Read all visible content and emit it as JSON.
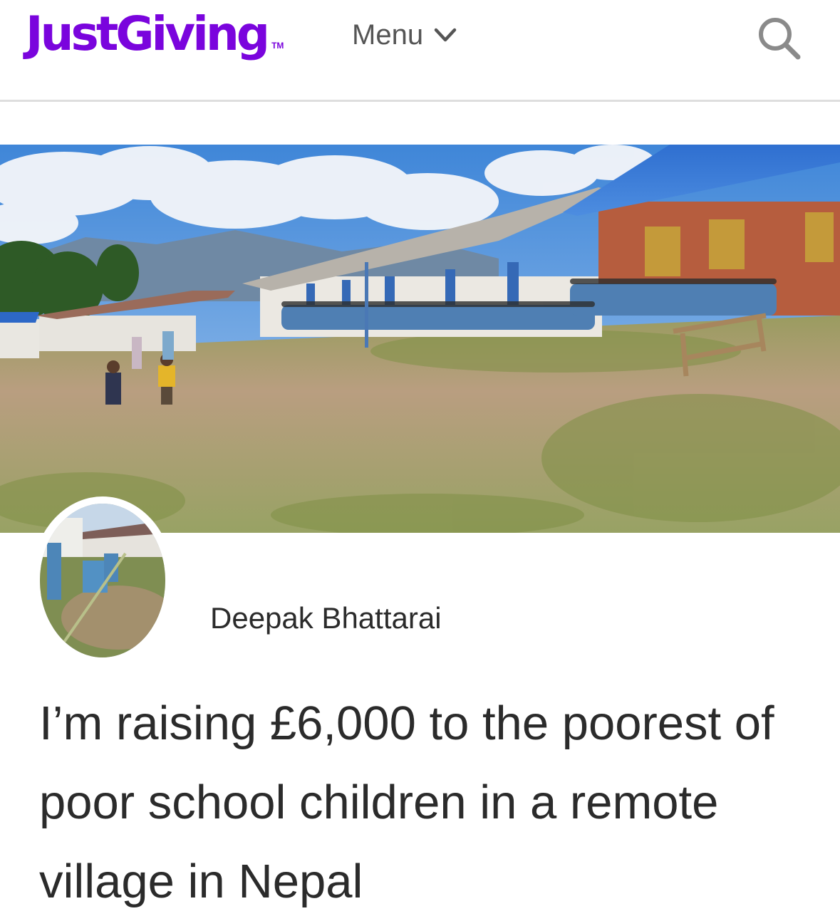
{
  "header": {
    "logo_text": "JustGiving",
    "logo_tm": "TM",
    "menu_label": "Menu",
    "menu_icon": "chevron-down-icon",
    "search_icon": "search-icon",
    "brand_color": "#7a04dd"
  },
  "page": {
    "fundraiser_name": "Deepak Bhattarai",
    "headline": "I’m raising £6,000 to the poorest of poor school children in a remote village in Nepal"
  }
}
